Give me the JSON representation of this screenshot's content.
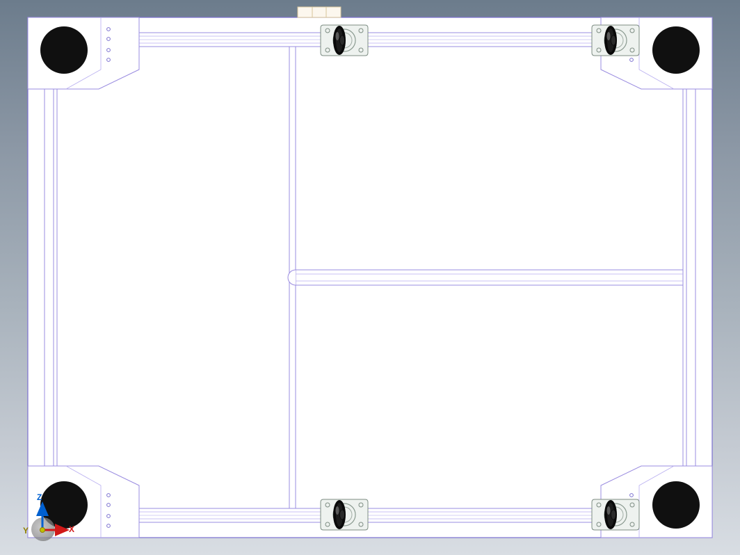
{
  "cad_view": {
    "triad": {
      "x_label": "X",
      "y_label": "Y",
      "z_label": "Z"
    },
    "colors": {
      "edge": "#9a8ce0",
      "edge_dark": "#7a6fd0",
      "face": "#ffffff",
      "wheel_dark": "#101010",
      "wheel_shine": "#606060",
      "bracket": "#95a59a",
      "rivet": "#4a4a7a",
      "tab": "#e8d8b8",
      "x_axis": "#d01818",
      "y_axis": "#c0c000",
      "z_axis": "#0060d0"
    },
    "layout_notes": {
      "description": "Orthographic right-side view of a rectangular sheet-metal enclosure / cart base. Four large corner feet (black discs), four chamfered corner plates with rivet holes, two horizontal extrusion rails near top and bottom spanning width, two pairs of caster wheels on brackets attached to the rails (four casters total), internal vertical divider slightly left of center, a horizontal mid shelf extrusion in the right half, inset vertical stiffeners near left and right walls, small tab/stub protruding from top edge.",
      "view": "Right (XZ plane)"
    }
  }
}
